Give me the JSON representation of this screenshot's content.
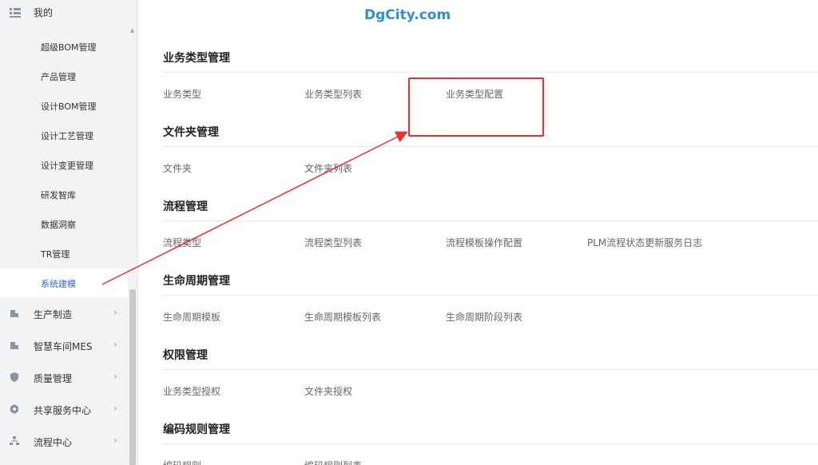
{
  "watermark": "DgCity.com",
  "sidebar": {
    "top": {
      "label": "我的"
    },
    "sub_items": [
      {
        "label": "超级BOM管理"
      },
      {
        "label": "产品管理"
      },
      {
        "label": "设计BOM管理"
      },
      {
        "label": "设计工艺管理"
      },
      {
        "label": "设计变更管理"
      },
      {
        "label": "研发智库"
      },
      {
        "label": "数据洞察"
      },
      {
        "label": "TR管理"
      },
      {
        "label": "系统建模"
      }
    ],
    "menu_items": [
      {
        "label": "生产制造",
        "icon": "factory-icon"
      },
      {
        "label": "智慧车间MES",
        "icon": "workshop-icon"
      },
      {
        "label": "质量管理",
        "icon": "shield-icon"
      },
      {
        "label": "共享服务中心",
        "icon": "service-icon"
      },
      {
        "label": "流程中心",
        "icon": "flow-icon"
      }
    ],
    "active_item": "系统建模"
  },
  "sections": [
    {
      "title": "业务类型管理",
      "links": [
        "业务类型",
        "业务类型列表",
        "业务类型配置"
      ]
    },
    {
      "title": "文件夹管理",
      "links": [
        "文件夹",
        "文件夹列表"
      ]
    },
    {
      "title": "流程管理",
      "links": [
        "流程类型",
        "流程类型列表",
        "流程模板操作配置",
        "PLM流程状态更新服务日志"
      ]
    },
    {
      "title": "生命周期管理",
      "links": [
        "生命周期模板",
        "生命周期模板列表",
        "生命周期阶段列表"
      ]
    },
    {
      "title": "权限管理",
      "links": [
        "业务类型授权",
        "文件夹授权"
      ]
    },
    {
      "title": "编码规则管理",
      "links": [
        "编码规则",
        "编码规则列表"
      ]
    }
  ],
  "colors": {
    "accent": "#2f6bd8",
    "annotation": "#e8302c",
    "watermark": "#2f8ed8"
  }
}
